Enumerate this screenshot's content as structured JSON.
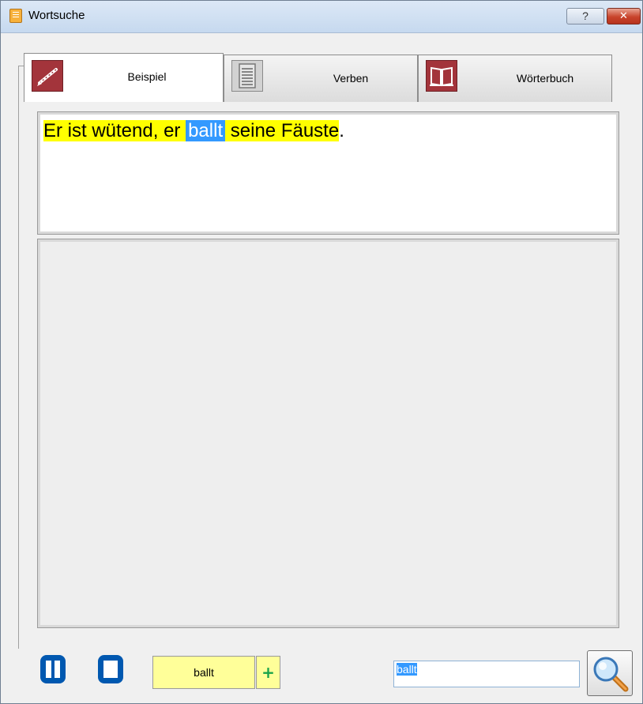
{
  "window": {
    "title": "Wortsuche",
    "help_label": "?",
    "close_label": "✕"
  },
  "tabs": [
    {
      "label": "Beispiel",
      "icon": "pen-icon",
      "active": true
    },
    {
      "label": "Verben",
      "icon": "document-icon",
      "active": false
    },
    {
      "label": "Wörterbuch",
      "icon": "book-icon",
      "active": false
    }
  ],
  "example": {
    "part1": "Er ist wütend, er",
    "highlight": "ballt",
    "part2": "seine Fäuste",
    "end": "."
  },
  "controls": {
    "word_label": "ballt",
    "add_label": "+",
    "search_value": "ballt"
  },
  "colors": {
    "sentence_highlight": "#ffff00",
    "selection": "#3399ff",
    "word_button_bg": "#ffff99",
    "media_blue": "#0058b0",
    "tab_icon_red": "#a3343b"
  }
}
